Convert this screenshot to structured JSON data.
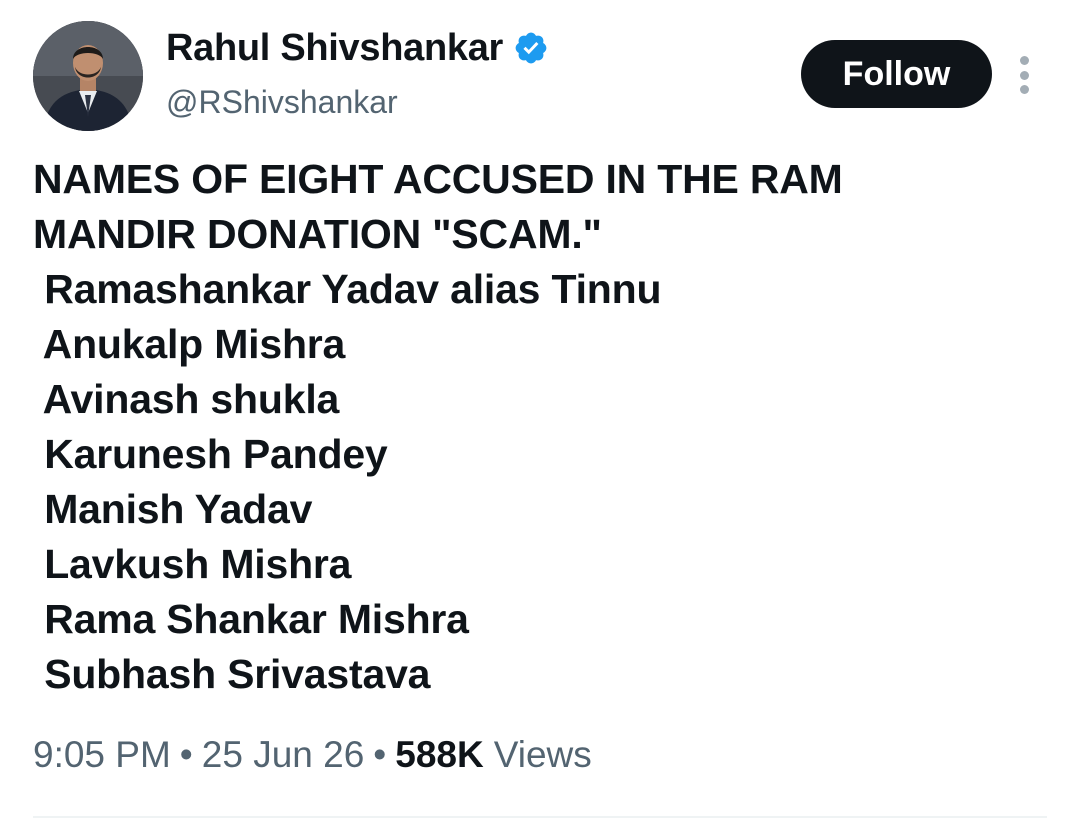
{
  "author": {
    "display_name": "Rahul Shivshankar",
    "handle": "@RShivshankar",
    "verified": true
  },
  "actions": {
    "follow_label": "Follow"
  },
  "tweet": {
    "headline_lines": [
      "NAMES OF EIGHT ACCUSED IN THE RAM",
      "MANDIR DONATION \"SCAM.\""
    ],
    "names": [
      " Ramashankar Yadav alias Tinnu",
      " Anukalp Mishra",
      " Avinash shukla",
      " Karunesh Pandey",
      " Manish Yadav",
      " Lavkush Mishra",
      " Rama Shankar Mishra",
      " Subhash Srivastava"
    ]
  },
  "meta": {
    "time": "9:05 PM",
    "separator": "•",
    "date": "25 Jun 26",
    "views_count": "588K",
    "views_label": "Views"
  },
  "icons": {
    "verified": "verified-badge-icon",
    "more": "more-options-icon"
  },
  "colors": {
    "verified_blue": "#1d9bf0",
    "follow_button_bg": "#0f1419",
    "secondary_text": "#536471"
  }
}
